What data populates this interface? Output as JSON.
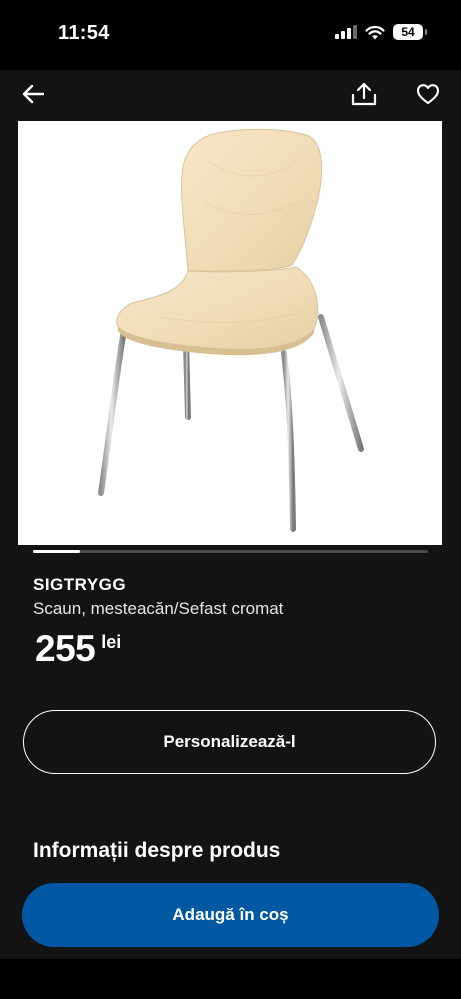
{
  "status_bar": {
    "time": "11:54",
    "battery": "54"
  },
  "product": {
    "brand": "SIGTRYGG",
    "description": "Scaun, mesteacăn/Sefast cromat",
    "price": "255",
    "currency": "lei",
    "image_progress": 0.12
  },
  "actions": {
    "personalize_label": "Personalizează-l",
    "add_to_cart_label": "Adaugă în coș"
  },
  "sections": {
    "info_heading": "Informații despre produs"
  },
  "icons": {
    "back": "arrow-left-icon",
    "share": "share-icon",
    "favorite": "heart-icon"
  },
  "colors": {
    "accent": "#0058a3",
    "background": "#131313"
  }
}
